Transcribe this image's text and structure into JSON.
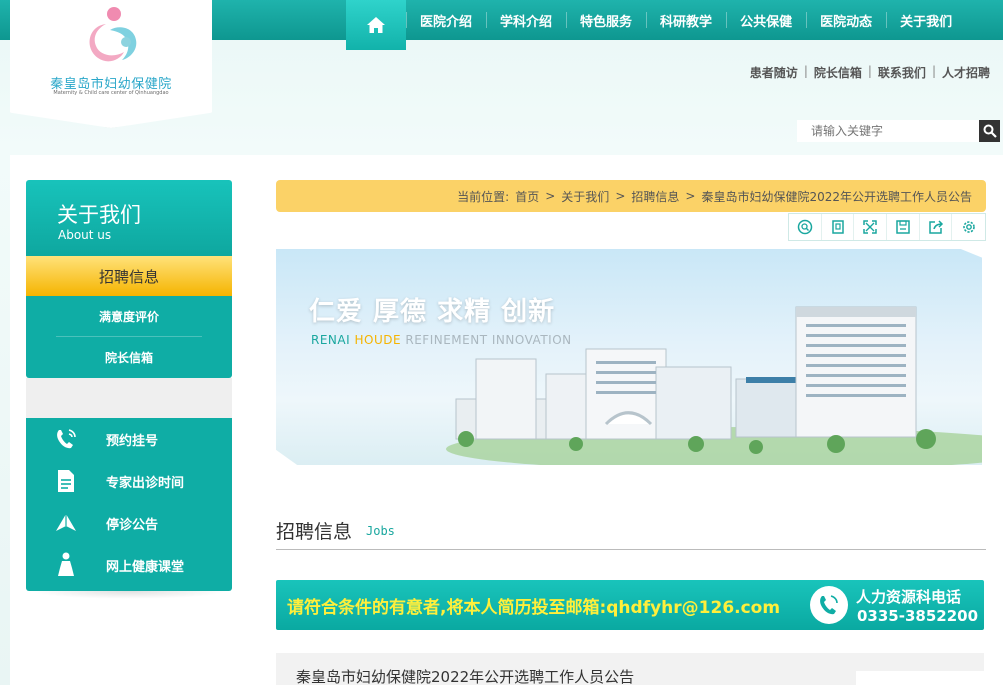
{
  "site": {
    "name_cn": "秦皇岛市妇幼保健院",
    "name_en": "Maternity & Child care center of Qinhuangdao",
    "brand_color": "#0fada5",
    "accent_color": "#fbd267"
  },
  "nav": {
    "home_icon": "home-icon",
    "items": [
      "医院介绍",
      "学科介绍",
      "特色服务",
      "科研教学",
      "公共保健",
      "医院动态",
      "关于我们"
    ]
  },
  "toplinks": [
    "患者随访",
    "院长信箱",
    "联系我们",
    "人才招聘"
  ],
  "toplinks_sep": "|",
  "search": {
    "placeholder": "请输入关键字",
    "icon": "search-icon"
  },
  "sidebar": {
    "title_cn": "关于我们",
    "title_en": "About us",
    "active": "招聘信息",
    "items": [
      "满意度评价",
      "院长信箱"
    ]
  },
  "quick_links": [
    {
      "label": "预约挂号",
      "icon": "phone-icon"
    },
    {
      "label": "专家出诊时间",
      "icon": "document-icon"
    },
    {
      "label": "停诊公告",
      "icon": "megaphone-icon"
    },
    {
      "label": "网上健康课堂",
      "icon": "person-icon"
    }
  ],
  "breadcrumb": {
    "prefix": "当前位置:",
    "items": [
      "首页",
      "关于我们",
      "招聘信息",
      "秦皇岛市妇幼保健院2022年公开选聘工作人员公告"
    ],
    "sep": ">"
  },
  "tools": [
    "search-circle-icon",
    "bookmark-icon",
    "fullscreen-icon",
    "save-icon",
    "share-icon",
    "settings-icon"
  ],
  "banner": {
    "slogan": "仁爱 厚德 求精 创新",
    "sub": [
      "RENAI",
      "HOUDE",
      "REFINEMENT",
      "INNOVATION"
    ]
  },
  "section": {
    "title": "招聘信息",
    "title_en": "Jobs"
  },
  "notice": {
    "text": "请符合条件的有意者,将本人简历投至邮箱:qhdfyhr@126.com",
    "hr_label": "人力资源科电话",
    "hr_phone": "0335-3852200"
  },
  "article": {
    "title": "秦皇岛市妇幼保健院2022年公开选聘工作人员公告"
  }
}
